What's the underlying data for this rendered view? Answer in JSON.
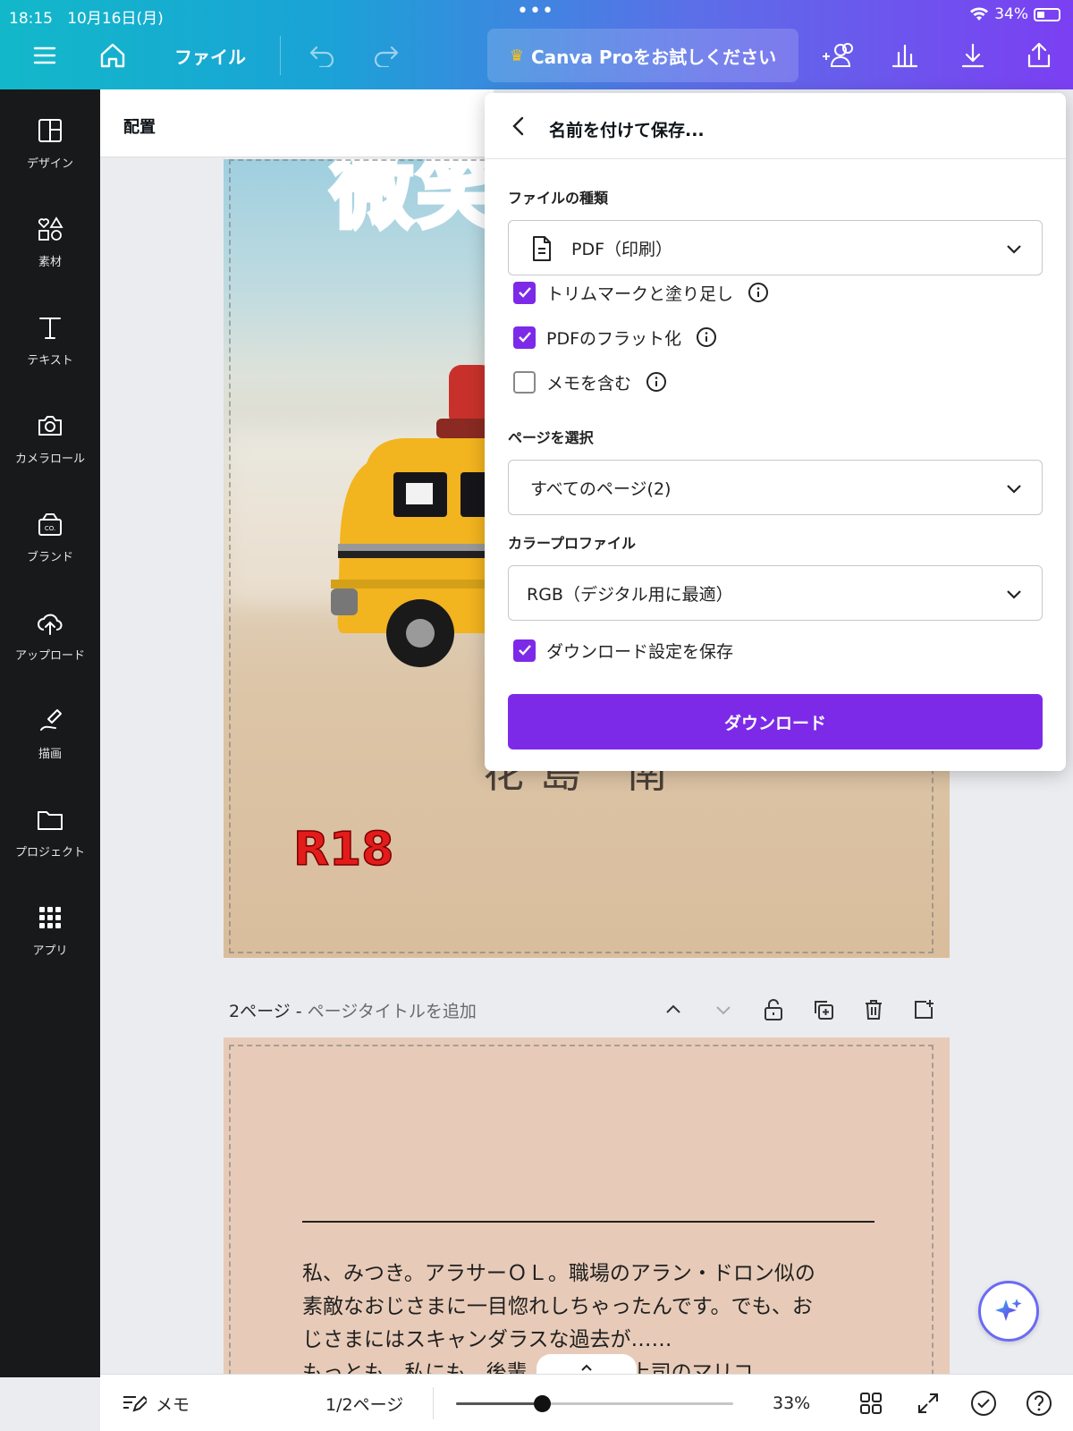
{
  "status_bar": {
    "time": "18:15",
    "date": "10月16日(月)",
    "dots": "•••",
    "battery": "34%"
  },
  "toolbar": {
    "file_label": "ファイル",
    "pro_label": "Canva Proをお試しください"
  },
  "sidebar": {
    "items": [
      {
        "label": "デザイン",
        "icon": "layout-icon"
      },
      {
        "label": "素材",
        "icon": "shapes-icon"
      },
      {
        "label": "テキスト",
        "icon": "text-icon"
      },
      {
        "label": "カメラロール",
        "icon": "camera-icon"
      },
      {
        "label": "ブランド",
        "icon": "brand-icon"
      },
      {
        "label": "アップロード",
        "icon": "upload-cloud-icon"
      },
      {
        "label": "描画",
        "icon": "draw-icon"
      },
      {
        "label": "プロジェクト",
        "icon": "folder-icon"
      },
      {
        "label": "アプリ",
        "icon": "apps-grid-icon"
      }
    ]
  },
  "context_bar": {
    "title": "配置"
  },
  "page1": {
    "title_fragment": "微笑",
    "author_fragment": "花島 南",
    "rating": "R18"
  },
  "page2": {
    "header": "2ページ - ",
    "header_sub": "ページタイトルを追加",
    "paragraph_lines": [
      "私、みつき。アラサーＯＬ。職場のアラン・ドロン似の",
      "素敵なおじさまに一目惚れしちゃったんです。でも、お",
      "じさまにはスキャンダラスな過去が……",
      "もっとも、私にも、後輩…と彼女の上司のマリコ"
    ]
  },
  "dialog": {
    "title": "名前を付けて保存...",
    "file_type_label": "ファイルの種類",
    "file_type_value": "PDF（印刷）",
    "options": [
      {
        "label": "トリムマークと塗り足し",
        "checked": true
      },
      {
        "label": "PDFのフラット化",
        "checked": true
      },
      {
        "label": "メモを含む",
        "checked": false
      }
    ],
    "pages_label": "ページを選択",
    "pages_value": "すべてのページ(2)",
    "color_profile_label": "カラープロファイル",
    "color_profile_value": "RGB（デジタル用に最適）",
    "save_settings_label": "ダウンロード設定を保存",
    "save_settings_checked": true,
    "download_label": "ダウンロード"
  },
  "bottom_bar": {
    "notes_label": "メモ",
    "page_indicator": "1/2ページ",
    "zoom": "33%",
    "zoom_fraction": 0.33
  },
  "colors": {
    "accent": "#7d2ae8",
    "sidebar_bg": "#18191b"
  }
}
